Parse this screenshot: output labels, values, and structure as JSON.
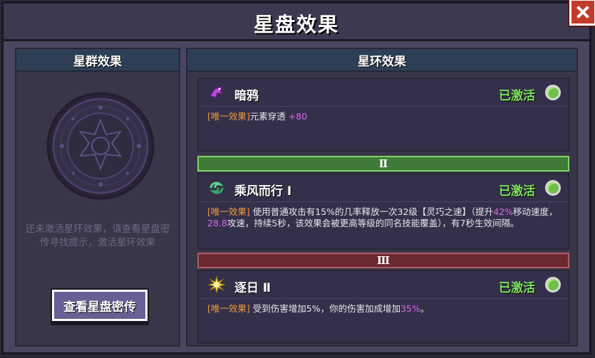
{
  "window": {
    "title": "星盘效果"
  },
  "left_panel": {
    "header": "星群效果",
    "hint": "还未激活星环效果，请查看星盘密传寻找提示，激活星环效果",
    "button_label": "查看星盘密传"
  },
  "right_panel": {
    "header": "星环效果",
    "entries": [
      {
        "name": "暗鸦",
        "status": "已激活",
        "tag": "[唯一效果]",
        "desc_parts": [
          "元素穿透 ",
          "+80"
        ]
      },
      {
        "tier": "Ⅱ",
        "name": "乘风而行 Ⅰ",
        "status": "已激活",
        "tag": "[唯一效果]",
        "desc_parts": [
          " 使用普通攻击有15%的几率释放一次32级【灵巧之速】（提升",
          "42%",
          "移动速度，",
          "28.8",
          "攻速，持续5秒，该效果会被更高等级的同名技能覆盖），有7秒生效间隔。"
        ]
      },
      {
        "tier": "Ⅲ",
        "name": "逐日 Ⅱ",
        "status": "已激活",
        "tag": "[唯一效果]",
        "desc_parts": [
          " 受到伤害增加5%，你的伤害加成增加",
          "35%",
          "。"
        ]
      }
    ]
  },
  "colors": {
    "accent_green": "#7ee55e",
    "tag_orange": "#ee9a3a",
    "highlight_purple": "#d66be8"
  },
  "icons": [
    "close-icon",
    "crow-icon",
    "wind-icon",
    "sun-icon",
    "star-disk-icon",
    "active-dot-icon"
  ]
}
